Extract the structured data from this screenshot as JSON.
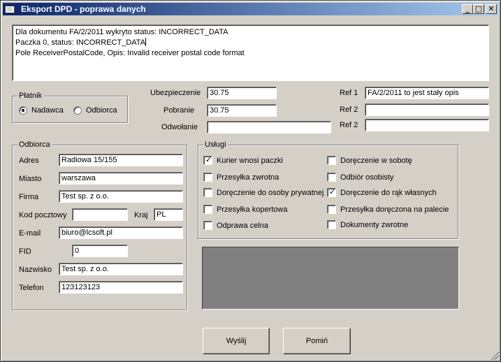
{
  "window": {
    "title": "Eksport DPD - poprawa danych",
    "controls": {
      "minimize": "_",
      "maximize": "□",
      "close": "✕"
    }
  },
  "log": {
    "lines": [
      "Dla dokumentu FA/2/2011 wykryto status: INCORRECT_DATA",
      "Paczka 0, status: INCORRECT_DATA",
      "Pole ReceiverPostalCode, Opis: Invalid receiver postal code format"
    ]
  },
  "platnik": {
    "title": "Płatnik",
    "options": [
      {
        "label": "Nadawca",
        "selected": true
      },
      {
        "label": "Odbiorca",
        "selected": false
      }
    ]
  },
  "middle": {
    "ubezpieczenie_label": "Ubezpieczenie",
    "ubezpieczenie_value": "30.75",
    "pobranie_label": "Pobranie",
    "pobranie_value": "30.75",
    "odwolanie_label": "Odwołanie",
    "odwolanie_value": ""
  },
  "refs": {
    "ref1_label": "Ref 1",
    "ref1_value": "FA/2/2011 to jest stały opis",
    "ref2_label": "Ref 2",
    "ref2_value": "",
    "ref3_label": "Ref 2",
    "ref3_value": ""
  },
  "odbiorca": {
    "title": "Odbiorca",
    "adres_label": "Adres",
    "adres_value": "Radiowa 15/155",
    "miasto_label": "Miasto",
    "miasto_value": "warszawa",
    "firma_label": "Firma",
    "firma_value": "Test sp. z o.o.",
    "kod_label": "Kod pocztowy",
    "kod_value": "",
    "kraj_label": "Kraj",
    "kraj_value": "PL",
    "email_label": "E-mail",
    "email_value": "biuro@lcsoft.pl",
    "fid_label": "FID",
    "fid_value": "0",
    "nazwisko_label": "Nazwisko",
    "nazwisko_value": "Test sp. z o.o.",
    "telefon_label": "Telefon",
    "telefon_value": "123123123"
  },
  "uslugi": {
    "title": "Usługi",
    "left": [
      {
        "label": "Kurier wnosi paczki",
        "checked": true
      },
      {
        "label": "Przesyłka zwrotna",
        "checked": false
      },
      {
        "label": "Doręczenie do osoby prywatnej",
        "checked": false
      },
      {
        "label": "Przesyłka kopertowa",
        "checked": false
      },
      {
        "label": "Odprawa celna",
        "checked": false
      }
    ],
    "right": [
      {
        "label": "Doręczenie w sobotę",
        "checked": false
      },
      {
        "label": "Odbiór osobisty",
        "checked": false
      },
      {
        "label": "Doręczenie do rąk własnych",
        "checked": true
      },
      {
        "label": "Przesyłka doręczona na palecie",
        "checked": false
      },
      {
        "label": "Dokumenty zwrotne",
        "checked": false
      }
    ]
  },
  "buttons": {
    "send": "Wyślij",
    "skip": "Pomiń"
  },
  "colors": {
    "titlebar_start": "#0a246a",
    "titlebar_end": "#a6caf0",
    "face": "#d4d0c8",
    "dark_panel": "#808080"
  }
}
